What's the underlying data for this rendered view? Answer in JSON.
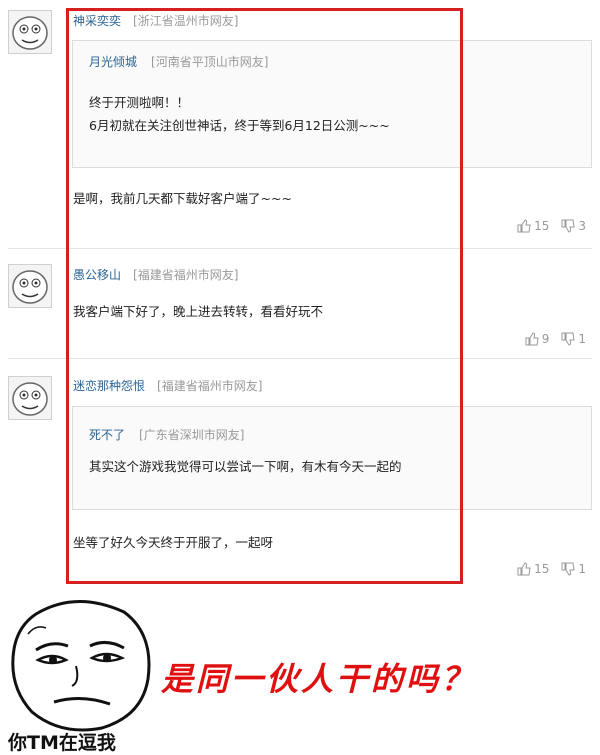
{
  "comments": [
    {
      "user": "神采奕奕",
      "location": "[浙江省温州市网友]",
      "quote": {
        "user": "月光倾城",
        "location": "[河南省平顶山市网友]",
        "lines": [
          "终于开测啦啊！！",
          "6月初就在关注创世神话，终于等到6月12日公测~~~"
        ]
      },
      "text": "是啊，我前几天都下载好客户端了~~~",
      "up": "15",
      "down": "3"
    },
    {
      "user": "愚公移山",
      "location": "[福建省福州市网友]",
      "text": "我客户端下好了，晚上进去转转，看看好玩不",
      "up": "9",
      "down": "1"
    },
    {
      "user": "迷恋那种怨恨",
      "location": "[福建省福州市网友]",
      "quote": {
        "user": "死不了",
        "location": "[广东省深圳市网友]",
        "lines": [
          "其实这个游戏我觉得可以尝试一下啊，有木有今天一起的"
        ]
      },
      "text": "坐等了好久今天终于开服了，一起呀",
      "up": "15",
      "down": "1"
    }
  ],
  "meme": {
    "caption": "你TM在逗我",
    "question": "是同一伙人干的吗？"
  },
  "colors": {
    "highlight_border": "#d42020",
    "username": "#2a6496",
    "question_text": "#e01010"
  },
  "icons": [
    "avatar-troll-icon",
    "thumb-up-icon",
    "thumb-down-icon",
    "meme-face-icon"
  ]
}
